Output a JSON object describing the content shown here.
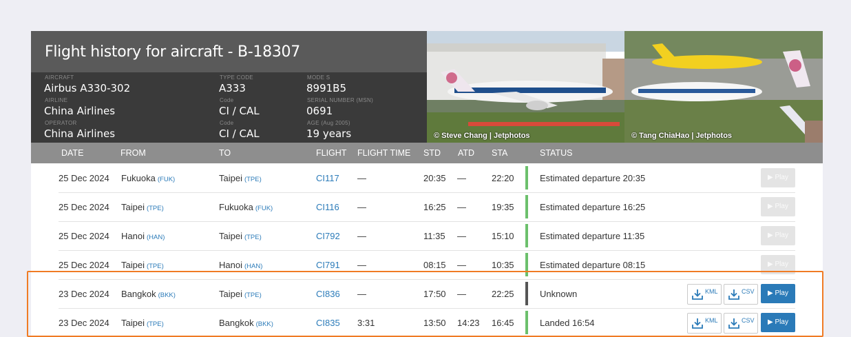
{
  "header": {
    "title": "Flight history for aircraft - B-18307",
    "fields": [
      {
        "label": "AIRCRAFT",
        "value": "Airbus A330-302"
      },
      {
        "label": "AIRLINE",
        "value": "China Airlines"
      },
      {
        "label": "OPERATOR",
        "value": "China Airlines"
      },
      {
        "label": "TYPE CODE",
        "value": "A333"
      },
      {
        "label": "Code",
        "value": "CI / CAL"
      },
      {
        "label": "Code",
        "value": "CI / CAL"
      },
      {
        "label": "MODE S",
        "value": "8991B5"
      },
      {
        "label": "SERIAL NUMBER (MSN)",
        "value": "0691"
      },
      {
        "label": "AGE (Aug 2005)",
        "value": "19 years"
      }
    ]
  },
  "photos": [
    {
      "credit": "© Steve Chang | Jetphotos"
    },
    {
      "credit": "© Tang ChiaHao | Jetphotos"
    }
  ],
  "table": {
    "columns": [
      "DATE",
      "FROM",
      "TO",
      "FLIGHT",
      "FLIGHT TIME",
      "STD",
      "ATD",
      "STA",
      "STATUS"
    ],
    "rows": [
      {
        "date": "25 Dec 2024",
        "from": "Fukuoka",
        "from_code": "(FUK)",
        "to": "Taipei",
        "to_code": "(TPE)",
        "flight": "CI117",
        "flight_time": "—",
        "std": "20:35",
        "atd": "—",
        "sta": "22:20",
        "status": "Estimated departure 20:35",
        "status_color": "#6cc06c",
        "play": "Play",
        "play_enabled": false
      },
      {
        "date": "25 Dec 2024",
        "from": "Taipei",
        "from_code": "(TPE)",
        "to": "Fukuoka",
        "to_code": "(FUK)",
        "flight": "CI116",
        "flight_time": "—",
        "std": "16:25",
        "atd": "—",
        "sta": "19:35",
        "status": "Estimated departure 16:25",
        "status_color": "#6cc06c",
        "play": "Play",
        "play_enabled": false
      },
      {
        "date": "25 Dec 2024",
        "from": "Hanoi",
        "from_code": "(HAN)",
        "to": "Taipei",
        "to_code": "(TPE)",
        "flight": "CI792",
        "flight_time": "—",
        "std": "11:35",
        "atd": "—",
        "sta": "15:10",
        "status": "Estimated departure 11:35",
        "status_color": "#6cc06c",
        "play": "Play",
        "play_enabled": false
      },
      {
        "date": "25 Dec 2024",
        "from": "Taipei",
        "from_code": "(TPE)",
        "to": "Hanoi",
        "to_code": "(HAN)",
        "flight": "CI791",
        "flight_time": "—",
        "std": "08:15",
        "atd": "—",
        "sta": "10:35",
        "status": "Estimated departure 08:15",
        "status_color": "#6cc06c",
        "play": "Play",
        "play_enabled": false
      },
      {
        "date": "23 Dec 2024",
        "from": "Bangkok",
        "from_code": "(BKK)",
        "to": "Taipei",
        "to_code": "(TPE)",
        "flight": "CI836",
        "flight_time": "—",
        "std": "17:50",
        "atd": "—",
        "sta": "22:25",
        "status": "Unknown",
        "status_color": "#555555",
        "play": "Play",
        "play_enabled": true,
        "kml": "KML",
        "csv": "CSV"
      },
      {
        "date": "23 Dec 2024",
        "from": "Taipei",
        "from_code": "(TPE)",
        "to": "Bangkok",
        "to_code": "(BKK)",
        "flight": "CI835",
        "flight_time": "3:31",
        "std": "13:50",
        "atd": "14:23",
        "sta": "16:45",
        "status": "Landed 16:54",
        "status_color": "#6cc06c",
        "play": "Play",
        "play_enabled": true,
        "kml": "KML",
        "csv": "CSV"
      }
    ]
  },
  "colors": {
    "accent": "#2a7ab8",
    "highlight": "#f07b24",
    "status_ok": "#6cc06c"
  }
}
